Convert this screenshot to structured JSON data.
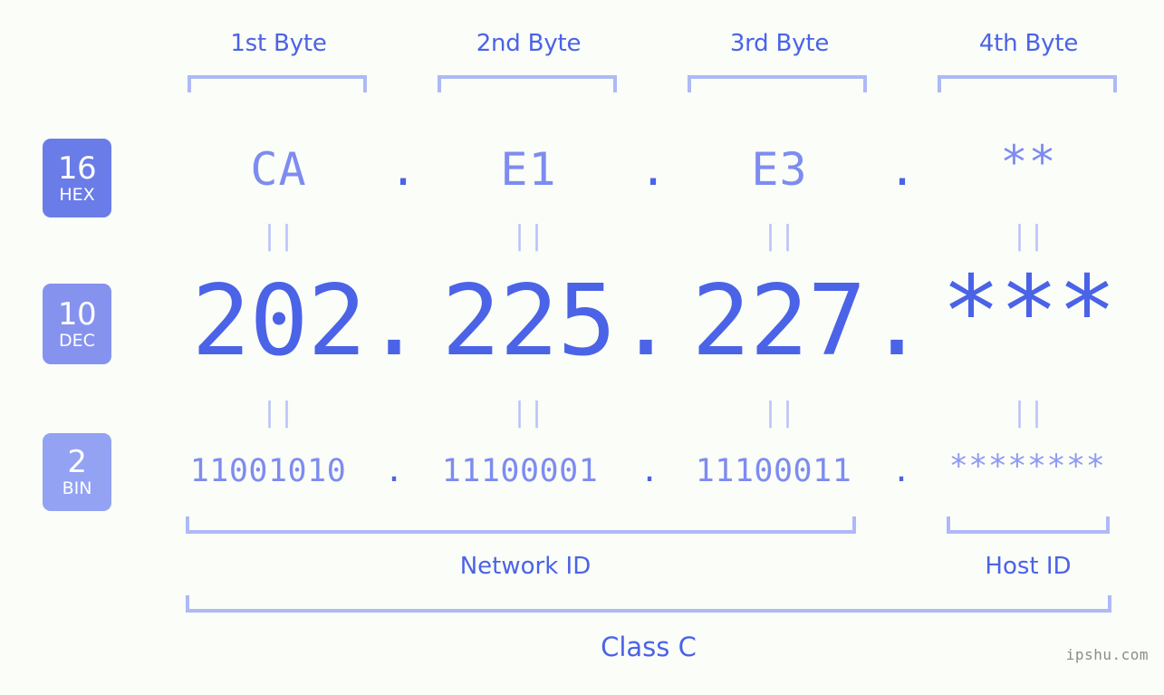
{
  "page": {
    "background_color": "#fbfdf8",
    "accent_color": "#4a63e7",
    "light_accent_color": "#aeb9f7",
    "watermark": "ipshu.com"
  },
  "byte_headers": [
    {
      "label": "1st Byte"
    },
    {
      "label": "2nd Byte"
    },
    {
      "label": "3rd Byte"
    },
    {
      "label": "4th Byte"
    }
  ],
  "rows": [
    {
      "badge_number": "16",
      "badge_label": "HEX",
      "badge_color": "#6a7ce8",
      "values": [
        "CA",
        "E1",
        "E3",
        "**"
      ],
      "separator": "."
    },
    {
      "badge_number": "10",
      "badge_label": "DEC",
      "badge_color": "#8593ee",
      "values": [
        "202",
        "225",
        "227",
        "***"
      ],
      "separator": "."
    },
    {
      "badge_number": "2",
      "badge_label": "BIN",
      "badge_color": "#93a2f3",
      "values": [
        "11001010",
        "11100001",
        "11100011",
        "********"
      ],
      "separator": "."
    }
  ],
  "equals_marks": {
    "symbol": "||",
    "rows": 2,
    "columns": 4
  },
  "segments": {
    "network_id": "Network ID",
    "host_id": "Host ID",
    "class": "Class C"
  }
}
